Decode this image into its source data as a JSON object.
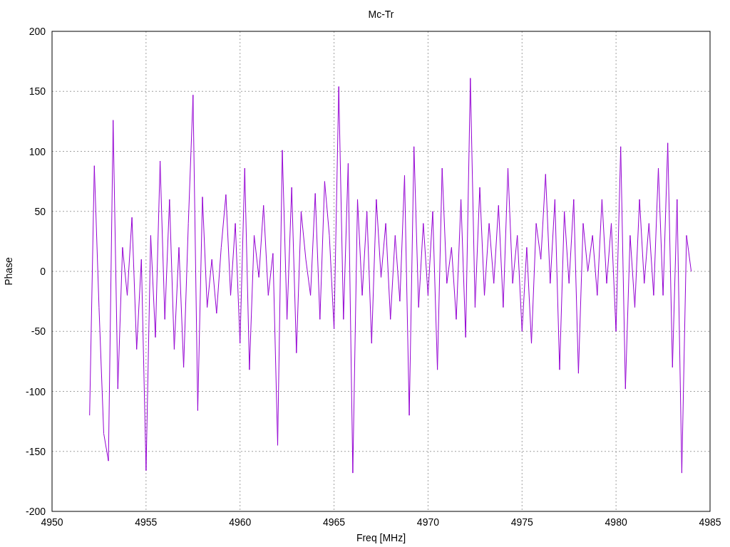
{
  "chart_data": {
    "type": "line",
    "grid": true,
    "title": "Mc-Tr",
    "xlabel": "Freq [MHz]",
    "ylabel": "Phase",
    "xlim": [
      4950,
      4985
    ],
    "ylim": [
      -200,
      200
    ],
    "xticks": [
      4950,
      4955,
      4960,
      4965,
      4970,
      4975,
      4980,
      4985
    ],
    "yticks": [
      -200,
      -150,
      -100,
      -50,
      0,
      50,
      100,
      150,
      200
    ],
    "x": [
      4952,
      4952.25,
      4952.5,
      4952.75,
      4953,
      4953.25,
      4953.5,
      4953.75,
      4954,
      4954.25,
      4954.5,
      4954.75,
      4955,
      4955.25,
      4955.5,
      4955.75,
      4956,
      4956.25,
      4956.5,
      4956.75,
      4957,
      4957.25,
      4957.5,
      4957.75,
      4958,
      4958.25,
      4958.5,
      4958.75,
      4959,
      4959.25,
      4959.5,
      4959.75,
      4960,
      4960.25,
      4960.5,
      4960.75,
      4961,
      4961.25,
      4961.5,
      4961.75,
      4962,
      4962.25,
      4962.5,
      4962.75,
      4963,
      4963.25,
      4963.5,
      4963.75,
      4964,
      4964.25,
      4964.5,
      4964.75,
      4965,
      4965.25,
      4965.5,
      4965.75,
      4966,
      4966.25,
      4966.5,
      4966.75,
      4967,
      4967.25,
      4967.5,
      4967.75,
      4968,
      4968.25,
      4968.5,
      4968.75,
      4969,
      4969.25,
      4969.5,
      4969.75,
      4970,
      4970.25,
      4970.5,
      4970.75,
      4971,
      4971.25,
      4971.5,
      4971.75,
      4972,
      4972.25,
      4972.5,
      4972.75,
      4973,
      4973.25,
      4973.5,
      4973.75,
      4974,
      4974.25,
      4974.5,
      4974.75,
      4975,
      4975.25,
      4975.5,
      4975.75,
      4976,
      4976.25,
      4976.5,
      4976.75,
      4977,
      4977.25,
      4977.5,
      4977.75,
      4978,
      4978.25,
      4978.5,
      4978.75,
      4979,
      4979.25,
      4979.5,
      4979.75,
      4980,
      4980.25,
      4980.5,
      4980.75,
      4981,
      4981.25,
      4981.5,
      4981.75,
      4982,
      4982.25,
      4982.5,
      4982.75,
      4983,
      4983.25,
      4983.5,
      4983.75,
      4984
    ],
    "series": [
      {
        "color": "#9400d3",
        "values": [
          -120,
          88,
          -30,
          -135,
          -158,
          126,
          -98,
          20,
          -20,
          45,
          -65,
          10,
          -166,
          30,
          -55,
          92,
          -40,
          60,
          -65,
          20,
          -80,
          40,
          147,
          -116,
          62,
          -30,
          10,
          -35,
          20,
          64,
          -20,
          40,
          -60,
          86,
          -82,
          30,
          -5,
          55,
          -20,
          15,
          -145,
          101,
          -40,
          70,
          -68,
          50,
          10,
          -20,
          65,
          -40,
          75,
          30,
          -48,
          154,
          -40,
          90,
          -168,
          60,
          -20,
          50,
          -60,
          60,
          -5,
          40,
          -40,
          30,
          -25,
          80,
          -120,
          104,
          -30,
          40,
          -20,
          50,
          -82,
          86,
          -10,
          20,
          -40,
          60,
          -55,
          161,
          -30,
          70,
          -20,
          40,
          -10,
          55,
          -30,
          86,
          -10,
          30,
          -50,
          20,
          -60,
          40,
          10,
          81,
          -10,
          60,
          -82,
          50,
          -10,
          60,
          -85,
          40,
          0,
          30,
          -20,
          60,
          -10,
          40,
          -50,
          104,
          -98,
          30,
          -30,
          60,
          -10,
          40,
          -20,
          86,
          -20,
          107,
          -80,
          60,
          -168,
          30,
          0
        ]
      }
    ]
  }
}
